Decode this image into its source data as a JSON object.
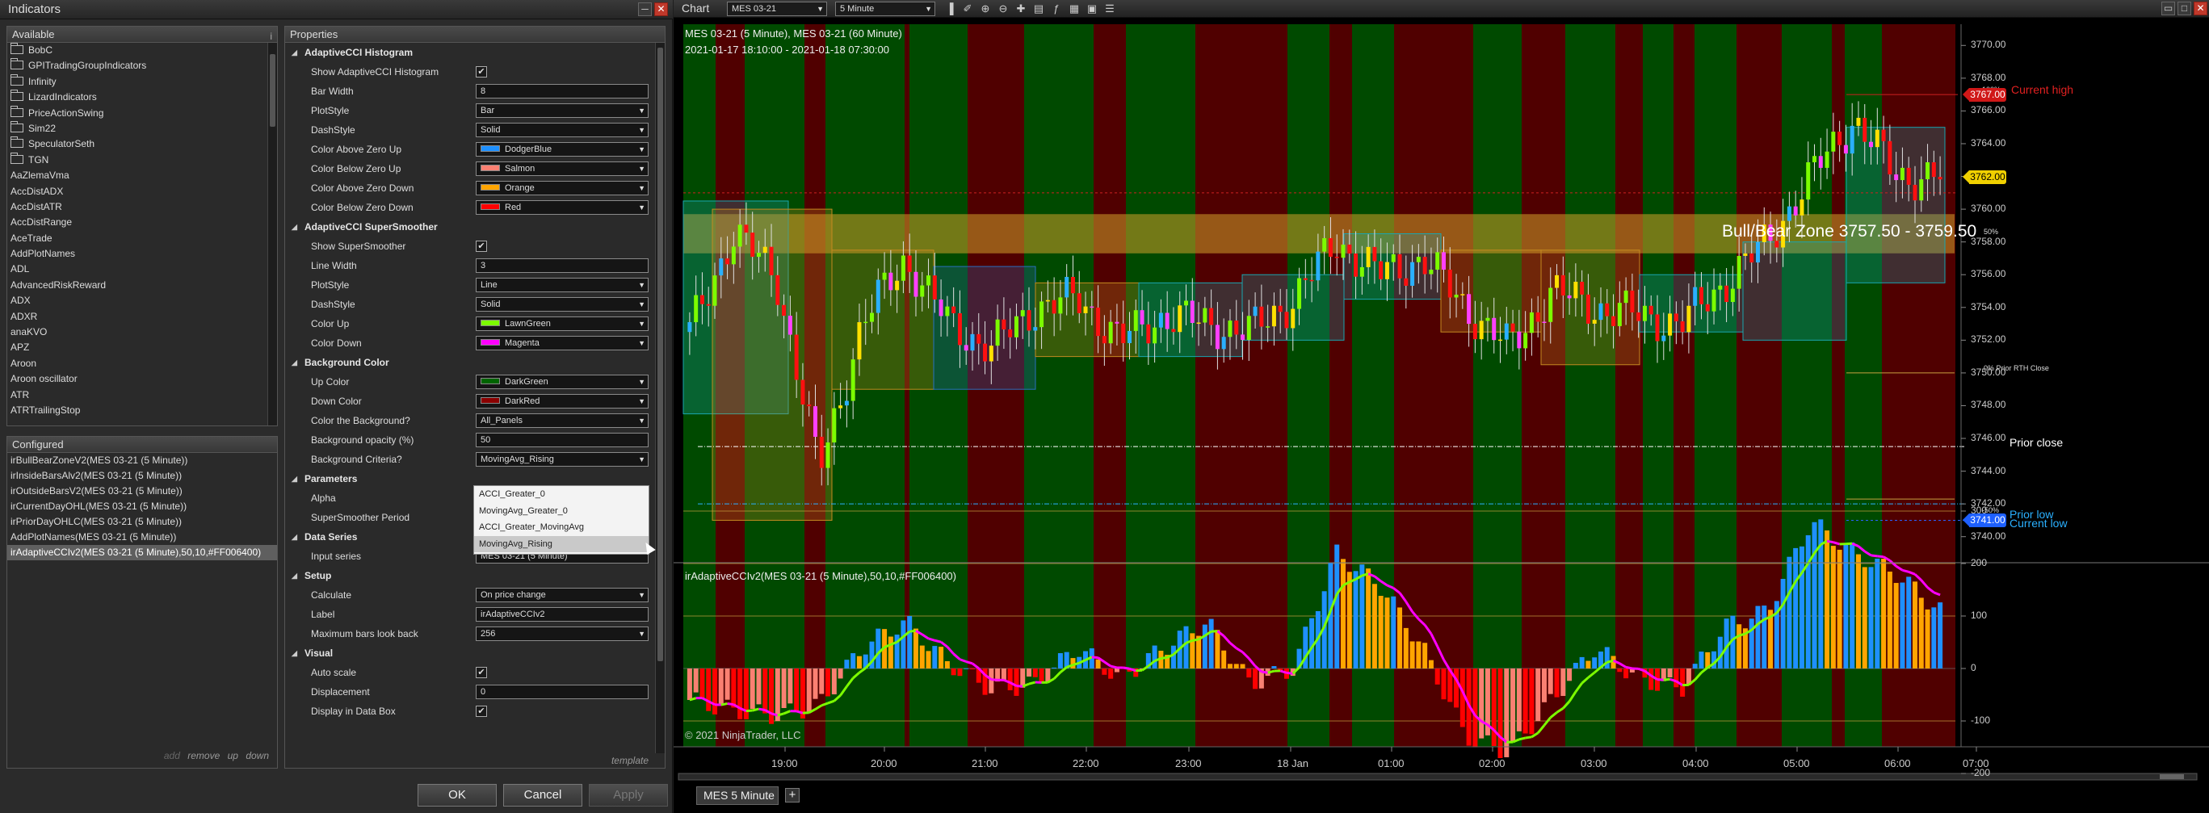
{
  "indicators_window": {
    "title": "Indicators",
    "available": {
      "header": "Available",
      "tools_glyph": "i",
      "folders": [
        "BobC",
        "GPITradingGroupIndicators",
        "Infinity",
        "LizardIndicators",
        "PriceActionSwing",
        "Sim22",
        "SpeculatorSeth",
        "TGN"
      ],
      "items": [
        "AaZlemaVma",
        "AccDistADX",
        "AccDistATR",
        "AccDistRange",
        "AceTrade",
        "AddPlotNames",
        "ADL",
        "AdvancedRiskReward",
        "ADX",
        "ADXR",
        "anaKVO",
        "APZ",
        "Aroon",
        "Aroon oscillator",
        "ATR",
        "ATRTrailingStop"
      ]
    },
    "configured": {
      "header": "Configured",
      "items": [
        "irBullBearZoneV2(MES 03-21 (5 Minute))",
        "irInsideBarsAlv2(MES 03-21 (5 Minute))",
        "irOutsideBarsV2(MES 03-21 (5 Minute))",
        "irCurrentDayOHL(MES 03-21 (5 Minute))",
        "irPriorDayOHLC(MES 03-21 (5 Minute))",
        "AddPlotNames(MES 03-21 (5 Minute))",
        "irAdaptiveCCIv2(MES 03-21 (5 Minute),50,10,#FF006400)"
      ],
      "selected_index": 6,
      "links": {
        "add": "add",
        "remove": "remove",
        "up": "up",
        "down": "down"
      }
    },
    "properties": {
      "header": "Properties",
      "sections": [
        {
          "title": "AdaptiveCCI Histogram",
          "rows": [
            {
              "name": "Show AdaptiveCCI Histogram",
              "type": "check",
              "value": "✔"
            },
            {
              "name": "Bar Width",
              "type": "text",
              "value": "8"
            },
            {
              "name": "PlotStyle",
              "type": "select",
              "value": "Bar"
            },
            {
              "name": "DashStyle",
              "type": "select",
              "value": "Solid"
            },
            {
              "name": "Color Above Zero Up",
              "type": "color",
              "value": "DodgerBlue",
              "swatch": "#1e90ff"
            },
            {
              "name": "Color Below Zero Up",
              "type": "color",
              "value": "Salmon",
              "swatch": "#fa8072"
            },
            {
              "name": "Color Above Zero Down",
              "type": "color",
              "value": "Orange",
              "swatch": "#ffa500"
            },
            {
              "name": "Color Below Zero Down",
              "type": "color",
              "value": "Red",
              "swatch": "#ff0000"
            }
          ]
        },
        {
          "title": "AdaptiveCCI SuperSmoother",
          "rows": [
            {
              "name": "Show SuperSmoother",
              "type": "check",
              "value": "✔"
            },
            {
              "name": "Line Width",
              "type": "text",
              "value": "3"
            },
            {
              "name": "PlotStyle",
              "type": "select",
              "value": "Line"
            },
            {
              "name": "DashStyle",
              "type": "select",
              "value": "Solid"
            },
            {
              "name": "Color Up",
              "type": "color",
              "value": "LawnGreen",
              "swatch": "#7cfc00"
            },
            {
              "name": "Color Down",
              "type": "color",
              "value": "Magenta",
              "swatch": "#ff00ff"
            }
          ]
        },
        {
          "title": "Background Color",
          "rows": [
            {
              "name": "Up Color",
              "type": "color",
              "value": "DarkGreen",
              "swatch": "#006400"
            },
            {
              "name": "Down Color",
              "type": "color",
              "value": "DarkRed",
              "swatch": "#8b0000"
            },
            {
              "name": "Color the Background?",
              "type": "select",
              "value": "All_Panels"
            },
            {
              "name": "Background opacity (%)",
              "type": "text",
              "value": "50"
            },
            {
              "name": "Background Criteria?",
              "type": "select",
              "value": "MovingAvg_Rising"
            }
          ]
        },
        {
          "title": "Parameters",
          "rows": [
            {
              "name": "Alpha",
              "type": "hidden",
              "value": ""
            },
            {
              "name": "SuperSmoother Period",
              "type": "hidden",
              "value": ""
            }
          ]
        },
        {
          "title": "Data Series",
          "rows": [
            {
              "name": "Input series",
              "type": "text",
              "value": "MES 03-21 (5 Minute)"
            }
          ]
        },
        {
          "title": "Setup",
          "rows": [
            {
              "name": "Calculate",
              "type": "select",
              "value": "On price change"
            },
            {
              "name": "Label",
              "type": "text",
              "value": "irAdaptiveCCIv2"
            },
            {
              "name": "Maximum bars look back",
              "type": "select",
              "value": "256"
            }
          ]
        },
        {
          "title": "Visual",
          "rows": [
            {
              "name": "Auto scale",
              "type": "check",
              "value": "✔"
            },
            {
              "name": "Displacement",
              "type": "text",
              "value": "0"
            },
            {
              "name": "Display in Data Box",
              "type": "check",
              "value": "✔"
            }
          ]
        }
      ],
      "criteria_dropdown": {
        "options": [
          "ACCI_Greater_0",
          "MovingAvg_Greater_0",
          "ACCI_Greater_MovingAvg",
          "MovingAvg_Rising"
        ],
        "highlighted_index": 3
      },
      "template_link": "template"
    },
    "buttons": {
      "ok": "OK",
      "cancel": "Cancel",
      "apply": "Apply"
    }
  },
  "chart_window": {
    "tab_label": "Chart",
    "instrument": "MES 03-21",
    "interval": "5 Minute",
    "header_line1": "MES 03-21 (5 Minute), MES 03-21 (60 Minute)",
    "header_line2": "2021-01-17 18:10:00 - 2021-01-18 07:30:00",
    "zone_label": "Bull/Bear Zone 3757.50 - 3759.50",
    "level_pcts": {
      "p100": "100%",
      "p50": "50%",
      "p0": "0% Prior RTH Close",
      "pm50": "-50%"
    },
    "level_names": {
      "current_high": "Current high",
      "prior_close": "Prior close",
      "prior_low": "Prior low",
      "current_low": "Current low"
    },
    "price_tags": [
      {
        "value": "3767.00",
        "bg": "#d01818",
        "fg": "#ffffff"
      },
      {
        "value": "3762.00",
        "bg": "#f0d000",
        "fg": "#000000"
      },
      {
        "value": "3741.00",
        "bg": "#1e60ff",
        "fg": "#ffffff"
      }
    ],
    "indicator_label": "irAdaptiveCCIv2(MES 03-21 (5 Minute),50,10,#FF006400)",
    "copyright": "© 2021 NinjaTrader, LLC",
    "bottom_tab": "MES  5 Minute",
    "add_tab_glyph": "+",
    "colors": {
      "up_bg": "#004a00",
      "down_bg": "#500000",
      "bull_bear_zone": "#d2a02a",
      "cci_up": "#1e90ff",
      "cci_down_above": "#ffa500",
      "cci_up_below": "#fa8072",
      "cci_down_below": "#ff0000",
      "ss_up": "#7cfc00",
      "ss_down": "#ff00ff"
    }
  },
  "chart_data": [
    {
      "type": "line",
      "title": "MES 03-21 (5 Minute), MES 03-21 (60 Minute)",
      "x_ticks": [
        "19:00",
        "20:00",
        "21:00",
        "22:00",
        "23:00",
        "18 Jan",
        "01:00",
        "02:00",
        "03:00",
        "04:00",
        "05:00",
        "06:00",
        "07:00"
      ],
      "y_ticks": [
        3770.0,
        3768.0,
        3766.0,
        3764.0,
        3762.0,
        3760.0,
        3758.0,
        3756.0,
        3754.0,
        3752.0,
        3750.0,
        3748.0,
        3746.0,
        3744.0,
        3742.0,
        3740.0
      ],
      "ylim": [
        3739,
        3771
      ],
      "series": [
        {
          "name": "MES 03-21 (5 Minute)",
          "x": [
            "18:10",
            "18:30",
            "18:50",
            "19:10",
            "19:30",
            "20:00",
            "20:30",
            "21:00",
            "21:30",
            "22:00",
            "22:30",
            "23:00",
            "23:30",
            "00:00",
            "00:30",
            "01:00",
            "01:30",
            "02:00",
            "02:30",
            "03:00",
            "03:30",
            "04:00",
            "04:30",
            "05:00",
            "05:30",
            "06:00",
            "06:15",
            "06:30",
            "07:00",
            "07:30"
          ],
          "values": [
            3752.5,
            3758.5,
            3756.0,
            3744.0,
            3753.0,
            3757.0,
            3753.0,
            3751.5,
            3754.0,
            3754.5,
            3752.0,
            3753.5,
            3753.0,
            3752.5,
            3754.5,
            3758.0,
            3756.0,
            3757.0,
            3754.0,
            3751.5,
            3755.0,
            3754.0,
            3753.5,
            3753.0,
            3755.5,
            3758.0,
            3762.0,
            3765.5,
            3762.0,
            3762.0
          ]
        }
      ],
      "levels": {
        "current_high": 3767.0,
        "bull_bear_zone": [
          3757.5,
          3759.5
        ],
        "prior_rth_close": 3750.0,
        "prior_close": 3745.5,
        "prior_low": 3742.0,
        "current_low": 3741.0
      }
    },
    {
      "type": "bar",
      "title": "irAdaptiveCCIv2(MES 03-21 (5 Minute),50,10,#FF006400)",
      "y_ticks": [
        300,
        200,
        100,
        0,
        -100,
        -200
      ],
      "ylim": [
        -260,
        340
      ],
      "series": [
        {
          "name": "AdaptiveCCI",
          "x": [
            "18:10",
            "18:30",
            "18:50",
            "19:10",
            "19:30",
            "20:00",
            "20:30",
            "21:00",
            "21:30",
            "22:00",
            "22:30",
            "23:00",
            "23:30",
            "00:00",
            "00:30",
            "01:00",
            "01:30",
            "02:00",
            "02:30",
            "03:00",
            "03:30",
            "04:00",
            "04:30",
            "05:00",
            "05:30",
            "06:00",
            "06:15",
            "06:30",
            "07:00",
            "07:30"
          ],
          "values": [
            -60,
            -80,
            -90,
            -70,
            40,
            90,
            10,
            -40,
            -30,
            40,
            -20,
            40,
            90,
            -30,
            0,
            220,
            160,
            40,
            -130,
            -160,
            -60,
            40,
            -20,
            -40,
            80,
            110,
            280,
            220,
            180,
            110
          ]
        }
      ]
    }
  ]
}
